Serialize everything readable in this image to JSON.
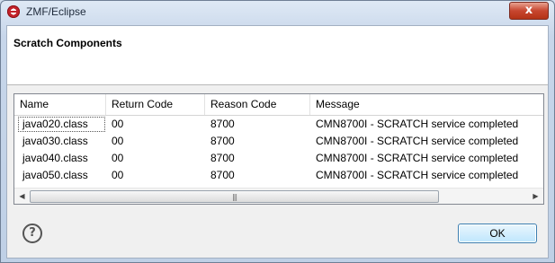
{
  "window": {
    "title": "ZMF/Eclipse",
    "close_glyph": "x"
  },
  "header": {
    "title": "Scratch Components"
  },
  "table": {
    "columns": [
      "Name",
      "Return Code",
      "Reason Code",
      "Message"
    ],
    "rows": [
      [
        "java020.class",
        "00",
        "8700",
        "CMN8700I - SCRATCH  service completed"
      ],
      [
        "java030.class",
        "00",
        "8700",
        "CMN8700I - SCRATCH  service completed"
      ],
      [
        "java040.class",
        "00",
        "8700",
        "CMN8700I - SCRATCH  service completed"
      ],
      [
        "java050.class",
        "00",
        "8700",
        "CMN8700I - SCRATCH  service completed"
      ]
    ]
  },
  "scrollbar": {
    "left_arrow": "◀",
    "right_arrow": "▶",
    "grip": "|||"
  },
  "footer": {
    "help_glyph": "?",
    "ok_label": "OK"
  },
  "icons": {
    "app": "eclipse-zmf-icon",
    "help": "help-icon",
    "close": "close-icon"
  }
}
